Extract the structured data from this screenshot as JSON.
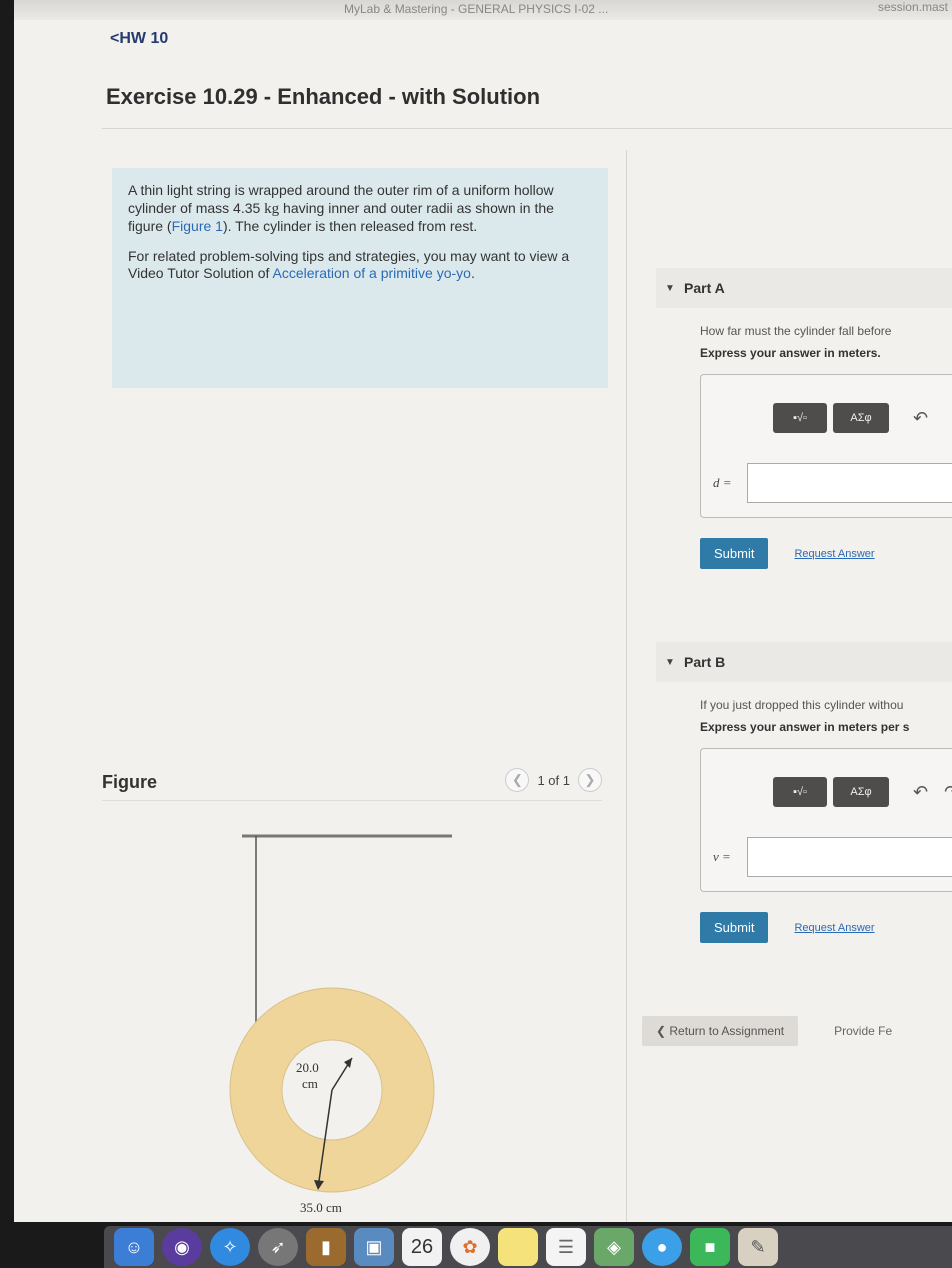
{
  "browser": {
    "tab_title": "MyLab & Mastering - GENERAL PHYSICS I-02 ...",
    "tab_session": "session.mast"
  },
  "header": {
    "back_link": "<HW 10",
    "title": "Exercise 10.29 - Enhanced - with Solution"
  },
  "problem": {
    "paragraph1_a": "A thin light string is wrapped around the outer rim of a uniform hollow cylinder of mass 4.35 ",
    "paragraph1_unit": "kg",
    "paragraph1_b": " having inner and outer radii as shown in the figure (",
    "paragraph1_link": "Figure 1",
    "paragraph1_c": "). The cylinder is then released from rest.",
    "paragraph2_a": "For related problem-solving tips and strategies, you may want to view a Video Tutor Solution of ",
    "paragraph2_link": "Acceleration of a primitive yo-yo",
    "paragraph2_b": "."
  },
  "figure": {
    "title": "Figure",
    "page_indicator": "1 of 1",
    "inner_radius_label_1": "20.0",
    "inner_radius_label_2": "cm",
    "outer_radius_label": "35.0 cm"
  },
  "part_a": {
    "label": "Part A",
    "question": "How far must the cylinder fall before",
    "instruction": "Express your answer in meters.",
    "template_btn": "▪√▫",
    "greek_btn": "ΑΣφ",
    "variable": "d =",
    "submit": "Submit",
    "request": "Request Answer"
  },
  "part_b": {
    "label": "Part B",
    "question": "If you just dropped this cylinder withou",
    "instruction": "Express your answer in meters per s",
    "template_btn": "▪√▫",
    "greek_btn": "ΑΣφ",
    "variable": "v =",
    "submit": "Submit",
    "request": "Request Answer"
  },
  "footer": {
    "return": "❮ Return to Assignment",
    "feedback": "Provide Fe"
  },
  "dock": {
    "calendar_day": "26"
  }
}
